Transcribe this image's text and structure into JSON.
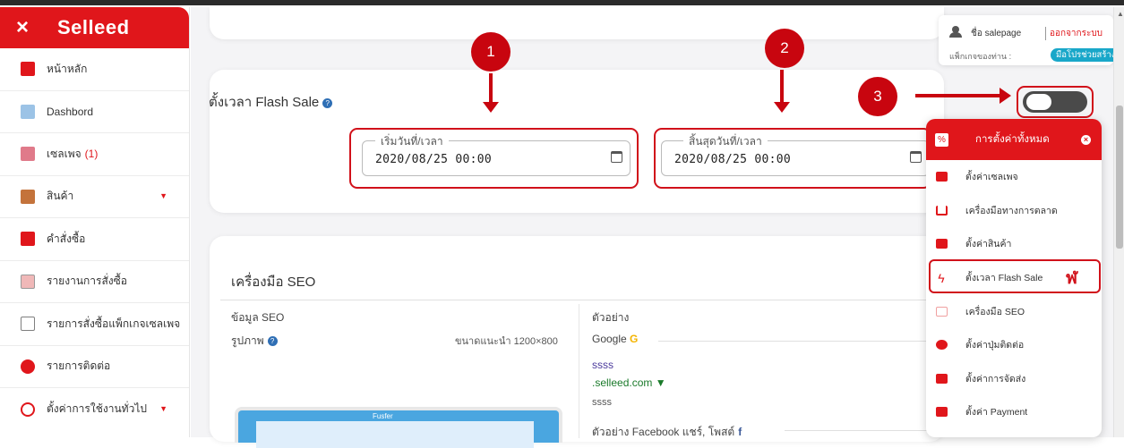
{
  "sidebar": {
    "logo": "Selleed",
    "close_icon": "×",
    "items": [
      {
        "label": "หน้าหลัก",
        "icon": "home-icon",
        "color": "#e0161b"
      },
      {
        "label": "Dashbord",
        "icon": "dashboard-icon",
        "color": "#9cc3e6"
      },
      {
        "label": "เซลเพจ",
        "badge": "(1)",
        "icon": "salepage-icon",
        "color": "#e07a8a"
      },
      {
        "label": "สินค้า",
        "icon": "products-icon",
        "color": "#c4733b",
        "has_arrow": true
      },
      {
        "label": "คำสั่งซื้อ",
        "icon": "orders-icon",
        "color": "#e0161b"
      },
      {
        "label": "รายงานการสั่งซื้อ",
        "icon": "report-icon",
        "color": "#f0b8b8"
      },
      {
        "label": "รายการสั่งซื้อแพ็กเกจเซลเพจ",
        "icon": "package-orders-icon",
        "color": "#7f7f7f"
      },
      {
        "label": "รายการติดต่อ",
        "icon": "contacts-icon",
        "color": "#e0161b"
      },
      {
        "label": "ตั้งค่าการใช้งานทั่วไป",
        "icon": "settings-icon",
        "color": "#e0161b",
        "has_arrow": true
      }
    ]
  },
  "flash_sale": {
    "title": "ตั้งเวลา Flash Sale",
    "start_label": "เริ่มวันที่/เวลา",
    "start_value": "2020/08/25 00:00",
    "end_label": "สิ้นสุดวันที่/เวลา",
    "end_value": "2020/08/25 00:00",
    "toggle_on": false
  },
  "markers": [
    "1",
    "2",
    "3"
  ],
  "seo": {
    "title": "เครื่องมือ SEO",
    "info_label": "ข้อมูล SEO",
    "image_label": "รูปภาพ",
    "image_hint": "ขนาดแนะนำ 1200×800",
    "preview_label": "ตัวอย่าง",
    "google_label": "Google",
    "google_g": "G",
    "preview_title": "ssss",
    "preview_url": ".selleed.com ▼",
    "preview_desc": "ssss",
    "facebook_label": "ตัวอย่าง Facebook แชร์, โพสต์",
    "facebook_f": "f",
    "laptop_brand": "Fusfer"
  },
  "user": {
    "name_label": "ชื่อ salepage",
    "logout": "ออกจากระบบ",
    "package_label": "แพ็กเกจของท่าน :",
    "package_value": "มือโปรช่วยสร้าง"
  },
  "menu": {
    "title": "การตั้งค่าทั้งหมด",
    "items": [
      {
        "label": "ตั้งค่าเซลเพจ",
        "icon": "store-icon",
        "color": "#e0161b"
      },
      {
        "label": "เครื่องมือทางการตลาด",
        "icon": "cart-icon",
        "color": "#e0161b"
      },
      {
        "label": "ตั้งค่าสินค้า",
        "icon": "box-icon",
        "color": "#e0161b"
      },
      {
        "label": "ตั้งเวลา Flash Sale",
        "icon": "lightning-icon",
        "color": "#e0161b"
      },
      {
        "label": "เครื่องมือ SEO",
        "icon": "seo-icon",
        "color": "#f0a0a0"
      },
      {
        "label": "ตั้งค่าปุ่มติดต่อ",
        "icon": "contact-button-icon",
        "color": "#e0161b"
      },
      {
        "label": "ตั้งค่าการจัดส่ง",
        "icon": "truck-icon",
        "color": "#e0161b"
      },
      {
        "label": "ตั้งค่า Payment",
        "icon": "payment-icon",
        "color": "#e0161b"
      }
    ],
    "pointer_char": "ฬ"
  }
}
